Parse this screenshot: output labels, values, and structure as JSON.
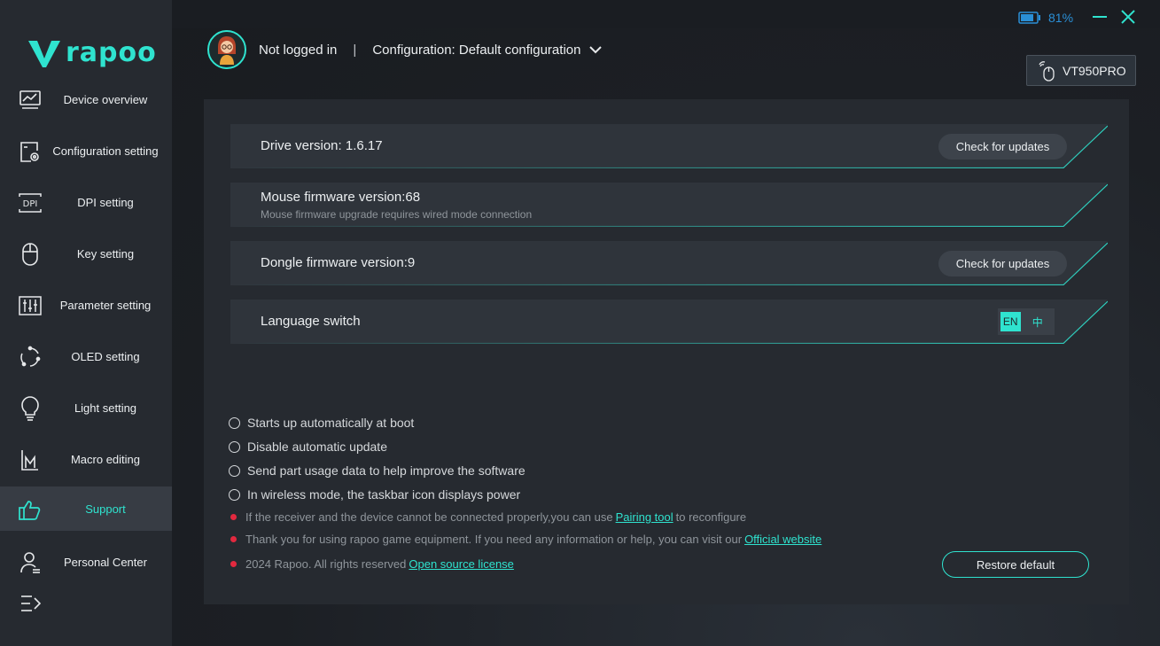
{
  "app": {
    "logo_text": "rapoo"
  },
  "sidebar": {
    "items": [
      {
        "label": "Device overview",
        "icon": "chart-monitor-icon"
      },
      {
        "label": "Configuration setting",
        "icon": "config-gear-icon"
      },
      {
        "label": "DPI setting",
        "icon": "dpi-icon"
      },
      {
        "label": "Key setting",
        "icon": "mouse-icon"
      },
      {
        "label": "Parameter setting",
        "icon": "sliders-icon"
      },
      {
        "label": "OLED setting",
        "icon": "oled-cycle-icon"
      },
      {
        "label": "Light setting",
        "icon": "bulb-icon"
      },
      {
        "label": "Macro editing",
        "icon": "macro-icon"
      },
      {
        "label": "Support",
        "icon": "thumbs-up-icon",
        "active": true
      },
      {
        "label": "Personal Center",
        "icon": "user-icon"
      }
    ]
  },
  "topbar": {
    "battery_pct": "81%"
  },
  "header": {
    "user_status": "Not logged in",
    "separator": "|",
    "configuration": "Configuration: Default configuration",
    "device_name": "VT950PRO"
  },
  "rows": {
    "drive": {
      "title": "Drive version: 1.6.17",
      "button": "Check for updates"
    },
    "mouse": {
      "title": "Mouse firmware version:68",
      "subtitle": "Mouse firmware upgrade requires wired mode connection"
    },
    "dongle": {
      "title": "Dongle firmware version:9",
      "button": "Check for updates"
    },
    "language": {
      "title": "Language switch",
      "en": "EN",
      "zh": "中"
    }
  },
  "options": [
    "Starts up automatically at boot",
    "Disable automatic update",
    "Send part usage data to help improve the software",
    "In wireless mode, the taskbar icon displays power"
  ],
  "notes": {
    "pairing_prefix": "If the receiver and the device cannot be connected properly,you can use",
    "pairing_link": "Pairing tool",
    "pairing_suffix": "to reconfigure",
    "thanks_prefix": "Thank you for using rapoo game equipment. If you need any information or help, you can visit our",
    "thanks_link": "Official website",
    "copyright": "2024 Rapoo. All rights reserved",
    "license_link": "Open source license"
  },
  "restore_label": "Restore default",
  "colors": {
    "accent": "#2fe3cf",
    "danger_dot": "#e2293f",
    "battery": "#2a8fd6"
  }
}
